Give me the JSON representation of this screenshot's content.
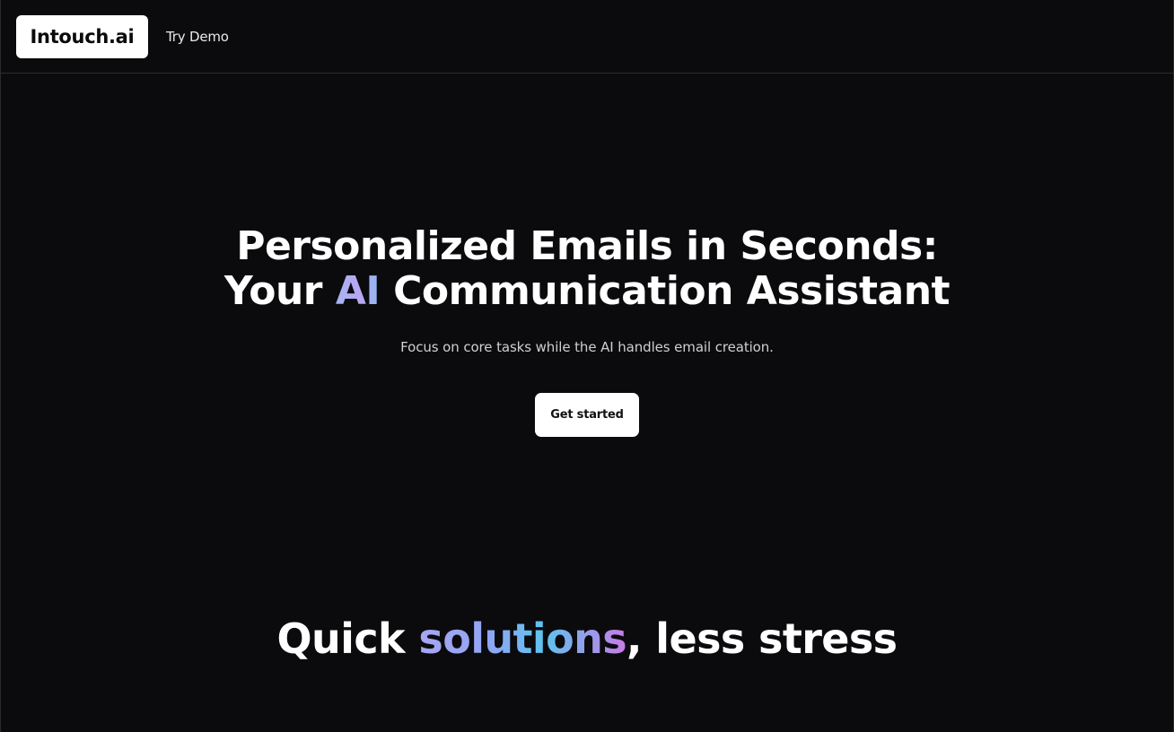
{
  "navbar": {
    "logo_text": "Intouch.ai",
    "links": [
      {
        "label": "Try Demo"
      }
    ]
  },
  "hero": {
    "headline_line1": "Personalized Emails in Seconds:",
    "headline_line2_pre": "Your ",
    "headline_line2_highlight": "AI",
    "headline_line2_post": " Communication Assistant",
    "subtitle": "Focus on core tasks while the AI handles email creation.",
    "cta_label": "Get started"
  },
  "section": {
    "title_pre": "Quick ",
    "title_highlight": "solutions",
    "title_post": ", less stress"
  },
  "colors": {
    "background": "#0b0b0d",
    "text": "#ffffff",
    "button_bg": "#ffffff",
    "gradient_ai": [
      "#a5b4f5",
      "#b8a7f0",
      "#8fb9f3"
    ],
    "gradient_solutions": [
      "#a7a6f2",
      "#8fa6f4",
      "#5ec3ef",
      "#c77be6"
    ]
  }
}
